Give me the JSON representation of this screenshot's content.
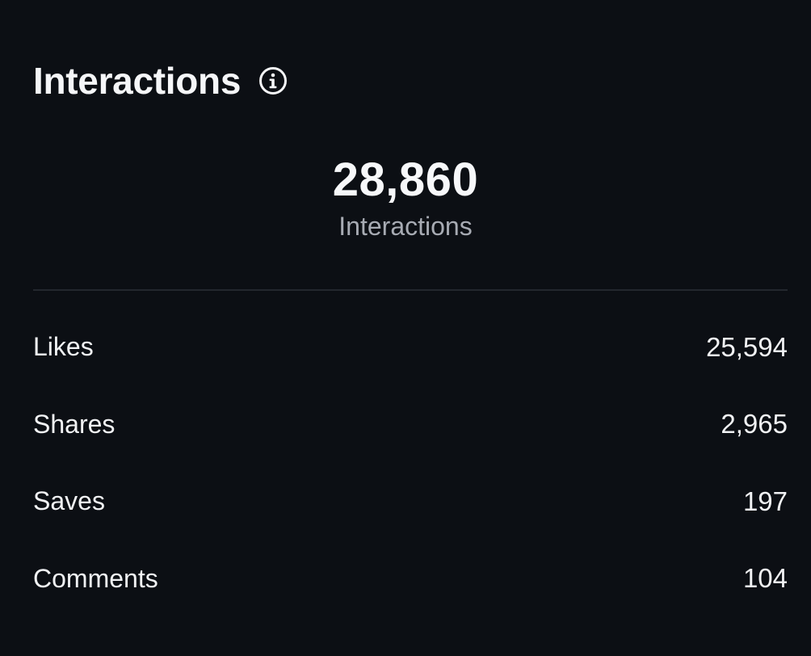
{
  "header": {
    "title": "Interactions",
    "info_icon": "info-circle-icon"
  },
  "summary": {
    "total": "28,860",
    "label": "Interactions"
  },
  "metrics": [
    {
      "label": "Likes",
      "value": "25,594"
    },
    {
      "label": "Shares",
      "value": "2,965"
    },
    {
      "label": "Saves",
      "value": "197"
    },
    {
      "label": "Comments",
      "value": "104"
    }
  ],
  "colors": {
    "background": "#0c0f14",
    "text_primary": "#f2f3f5",
    "text_secondary": "#a7abb3",
    "divider": "#23272e"
  }
}
